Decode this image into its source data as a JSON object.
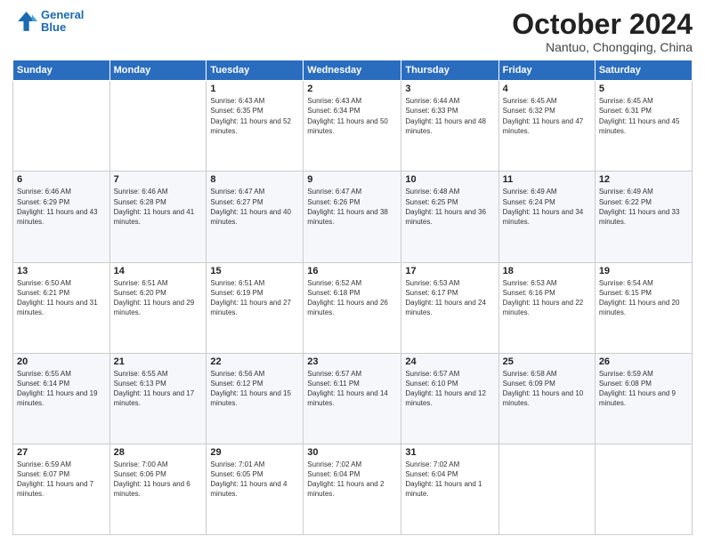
{
  "header": {
    "logo": {
      "line1": "General",
      "line2": "Blue"
    },
    "title": "October 2024",
    "subtitle": "Nantuo, Chongqing, China"
  },
  "weekdays": [
    "Sunday",
    "Monday",
    "Tuesday",
    "Wednesday",
    "Thursday",
    "Friday",
    "Saturday"
  ],
  "weeks": [
    [
      {
        "day": "",
        "info": ""
      },
      {
        "day": "",
        "info": ""
      },
      {
        "day": "1",
        "info": "Sunrise: 6:43 AM\nSunset: 6:35 PM\nDaylight: 11 hours and 52 minutes."
      },
      {
        "day": "2",
        "info": "Sunrise: 6:43 AM\nSunset: 6:34 PM\nDaylight: 11 hours and 50 minutes."
      },
      {
        "day": "3",
        "info": "Sunrise: 6:44 AM\nSunset: 6:33 PM\nDaylight: 11 hours and 48 minutes."
      },
      {
        "day": "4",
        "info": "Sunrise: 6:45 AM\nSunset: 6:32 PM\nDaylight: 11 hours and 47 minutes."
      },
      {
        "day": "5",
        "info": "Sunrise: 6:45 AM\nSunset: 6:31 PM\nDaylight: 11 hours and 45 minutes."
      }
    ],
    [
      {
        "day": "6",
        "info": "Sunrise: 6:46 AM\nSunset: 6:29 PM\nDaylight: 11 hours and 43 minutes."
      },
      {
        "day": "7",
        "info": "Sunrise: 6:46 AM\nSunset: 6:28 PM\nDaylight: 11 hours and 41 minutes."
      },
      {
        "day": "8",
        "info": "Sunrise: 6:47 AM\nSunset: 6:27 PM\nDaylight: 11 hours and 40 minutes."
      },
      {
        "day": "9",
        "info": "Sunrise: 6:47 AM\nSunset: 6:26 PM\nDaylight: 11 hours and 38 minutes."
      },
      {
        "day": "10",
        "info": "Sunrise: 6:48 AM\nSunset: 6:25 PM\nDaylight: 11 hours and 36 minutes."
      },
      {
        "day": "11",
        "info": "Sunrise: 6:49 AM\nSunset: 6:24 PM\nDaylight: 11 hours and 34 minutes."
      },
      {
        "day": "12",
        "info": "Sunrise: 6:49 AM\nSunset: 6:22 PM\nDaylight: 11 hours and 33 minutes."
      }
    ],
    [
      {
        "day": "13",
        "info": "Sunrise: 6:50 AM\nSunset: 6:21 PM\nDaylight: 11 hours and 31 minutes."
      },
      {
        "day": "14",
        "info": "Sunrise: 6:51 AM\nSunset: 6:20 PM\nDaylight: 11 hours and 29 minutes."
      },
      {
        "day": "15",
        "info": "Sunrise: 6:51 AM\nSunset: 6:19 PM\nDaylight: 11 hours and 27 minutes."
      },
      {
        "day": "16",
        "info": "Sunrise: 6:52 AM\nSunset: 6:18 PM\nDaylight: 11 hours and 26 minutes."
      },
      {
        "day": "17",
        "info": "Sunrise: 6:53 AM\nSunset: 6:17 PM\nDaylight: 11 hours and 24 minutes."
      },
      {
        "day": "18",
        "info": "Sunrise: 6:53 AM\nSunset: 6:16 PM\nDaylight: 11 hours and 22 minutes."
      },
      {
        "day": "19",
        "info": "Sunrise: 6:54 AM\nSunset: 6:15 PM\nDaylight: 11 hours and 20 minutes."
      }
    ],
    [
      {
        "day": "20",
        "info": "Sunrise: 6:55 AM\nSunset: 6:14 PM\nDaylight: 11 hours and 19 minutes."
      },
      {
        "day": "21",
        "info": "Sunrise: 6:55 AM\nSunset: 6:13 PM\nDaylight: 11 hours and 17 minutes."
      },
      {
        "day": "22",
        "info": "Sunrise: 6:56 AM\nSunset: 6:12 PM\nDaylight: 11 hours and 15 minutes."
      },
      {
        "day": "23",
        "info": "Sunrise: 6:57 AM\nSunset: 6:11 PM\nDaylight: 11 hours and 14 minutes."
      },
      {
        "day": "24",
        "info": "Sunrise: 6:57 AM\nSunset: 6:10 PM\nDaylight: 11 hours and 12 minutes."
      },
      {
        "day": "25",
        "info": "Sunrise: 6:58 AM\nSunset: 6:09 PM\nDaylight: 11 hours and 10 minutes."
      },
      {
        "day": "26",
        "info": "Sunrise: 6:59 AM\nSunset: 6:08 PM\nDaylight: 11 hours and 9 minutes."
      }
    ],
    [
      {
        "day": "27",
        "info": "Sunrise: 6:59 AM\nSunset: 6:07 PM\nDaylight: 11 hours and 7 minutes."
      },
      {
        "day": "28",
        "info": "Sunrise: 7:00 AM\nSunset: 6:06 PM\nDaylight: 11 hours and 6 minutes."
      },
      {
        "day": "29",
        "info": "Sunrise: 7:01 AM\nSunset: 6:05 PM\nDaylight: 11 hours and 4 minutes."
      },
      {
        "day": "30",
        "info": "Sunrise: 7:02 AM\nSunset: 6:04 PM\nDaylight: 11 hours and 2 minutes."
      },
      {
        "day": "31",
        "info": "Sunrise: 7:02 AM\nSunset: 6:04 PM\nDaylight: 11 hours and 1 minute."
      },
      {
        "day": "",
        "info": ""
      },
      {
        "day": "",
        "info": ""
      }
    ]
  ]
}
